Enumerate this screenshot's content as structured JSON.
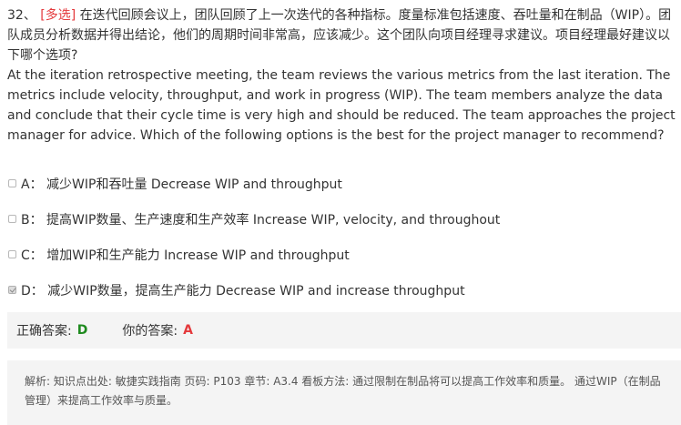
{
  "question": {
    "number": "32、",
    "tag": "[多选]",
    "text_cn": "在迭代回顾会议上，团队回顾了上一次迭代的各种指标。度量标准包括速度、吞吐量和在制品（WIP）。团队成员分析数据并得出结论，他们的周期时间非常高，应该减少。这个团队向项目经理寻求建议。项目经理最好建议以下哪个选项?",
    "text_en": "At the iteration retrospective meeting, the team reviews the various metrics from the last iteration. The metrics include velocity, throughput, and work in progress (WIP). The team members analyze the data and conclude that their cycle time is very high and should be reduced. The team approaches the project manager for advice. Which of the following options is the best for the project manager to recommend?"
  },
  "options": [
    {
      "text": "A：  减少WIP和吞吐量 Decrease WIP and throughput",
      "checked": false
    },
    {
      "text": "B：  提高WIP数量、生产速度和生产效率 Increase WIP, velocity, and throughout",
      "checked": false
    },
    {
      "text": "C：  增加WIP和生产能力 Increase WIP and throughput",
      "checked": false
    },
    {
      "text": "D：   减少WIP数量，提高生产能力 Decrease WIP and increase throughput",
      "checked": true
    }
  ],
  "answer": {
    "correct_label": "正确答案:",
    "correct_value": "D",
    "yours_label": "你的答案:",
    "yours_value": "A"
  },
  "explanation": "解析: 知识点出处:  敏捷实践指南 页码: P103 章节: A3.4 看板方法:  通过限制在制品将可以提高工作效率和质量。 通过WIP（在制品管理）来提高工作效率与质量。",
  "colors": {
    "tag_red": "#e4393c",
    "correct_green": "#1e8a1e",
    "panel_bg": "#f4f4f4"
  }
}
